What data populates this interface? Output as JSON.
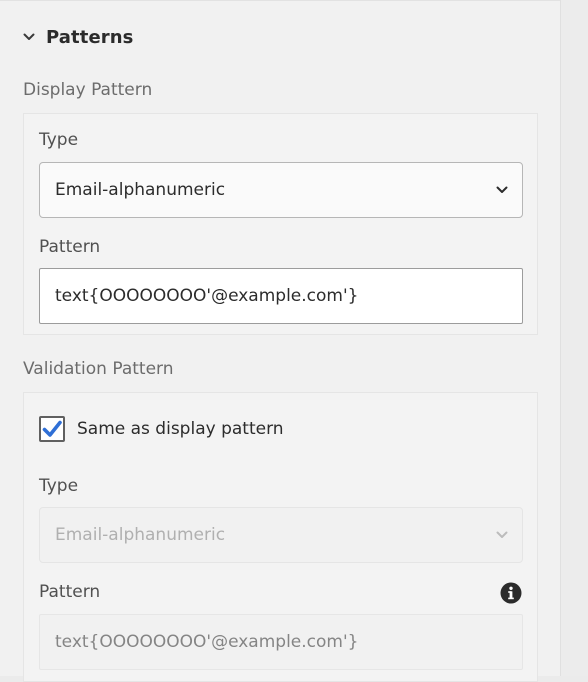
{
  "section": {
    "title": "Patterns",
    "expanded": true
  },
  "display_pattern": {
    "group_label": "Display Pattern",
    "type_label": "Type",
    "type_value": "Email-alphanumeric",
    "pattern_label": "Pattern",
    "pattern_value": "text{OOOOOOOO'@example.com'}"
  },
  "validation_pattern": {
    "group_label": "Validation Pattern",
    "same_as_display_label": "Same as display pattern",
    "same_as_display_checked": true,
    "type_label": "Type",
    "type_value": "Email-alphanumeric",
    "pattern_label": "Pattern",
    "pattern_value": "text{OOOOOOOO'@example.com'}",
    "disabled": true
  },
  "icons": {
    "section_chevron": "chevron-down-icon",
    "select_caret": "chevron-down-icon",
    "checkbox_check": "checkmark-icon",
    "info": "info-icon"
  },
  "colors": {
    "accent": "#2f6fd6",
    "panel_bg": "#f1f1f1",
    "text": "#2c2c2c",
    "muted_text": "#6c6c6c",
    "disabled_text": "#b0b0b0"
  }
}
